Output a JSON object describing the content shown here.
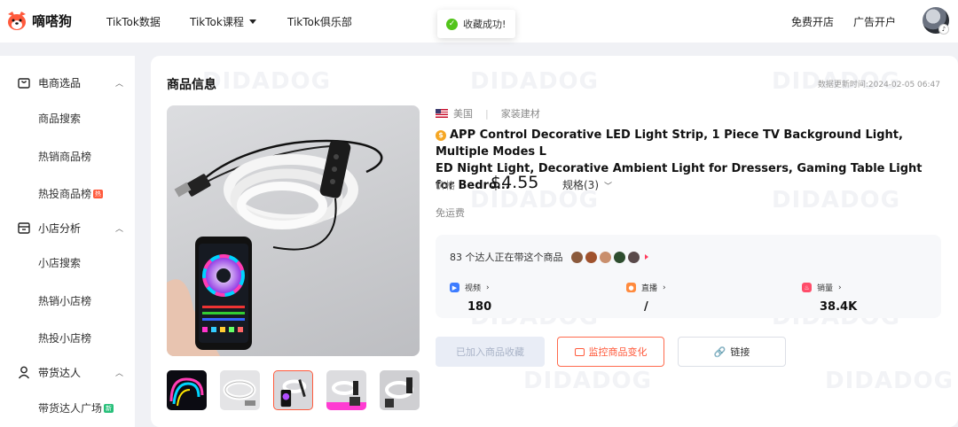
{
  "brand": {
    "name": "嘀嗒狗"
  },
  "nav": {
    "items": [
      "TikTok数据",
      "TikTok课程",
      "TikTok俱乐部"
    ],
    "right": [
      "免费开店",
      "广告开户"
    ]
  },
  "toast": {
    "text": "收藏成功!"
  },
  "sidebar": {
    "groups": [
      {
        "label": "电商选品",
        "items": [
          {
            "label": "商品搜索",
            "badge": ""
          },
          {
            "label": "热销商品榜",
            "badge": ""
          },
          {
            "label": "热投商品榜",
            "badge": "热"
          }
        ]
      },
      {
        "label": "小店分析",
        "items": [
          {
            "label": "小店搜索",
            "badge": ""
          },
          {
            "label": "热销小店榜",
            "badge": ""
          },
          {
            "label": "热投小店榜",
            "badge": ""
          }
        ]
      },
      {
        "label": "带货达人",
        "items": [
          {
            "label": "带货达人广场",
            "badge": "新"
          }
        ]
      }
    ]
  },
  "product": {
    "section_title": "商品信息",
    "update_time": "数据更新时间:2024-02-05 06:47",
    "country": "美国",
    "category": "家装建材",
    "title_line1": "APP Control Decorative LED Light Strip, 1 Piece TV Background Light, Multiple Modes L",
    "title_line2": "ED Night Light, Decorative Ambient Light for Dressers, Gaming Table Light for Bedro...",
    "price_label": "价格",
    "price": "$4.55",
    "spec": "规格(3)",
    "shipping": "免运费",
    "influencer_text": "83 个达人正在带这个商品",
    "stats": [
      {
        "label": "视频",
        "value": "180",
        "color": "#3d7cff"
      },
      {
        "label": "直播",
        "value": "/",
        "color": "#ff8a3d"
      },
      {
        "label": "销量",
        "value": "38.4K",
        "color": "#ff4d6a"
      }
    ],
    "buttons": {
      "favorited": "已加入商品收藏",
      "monitor": "监控商品变化",
      "link": "链接"
    }
  },
  "watermark": "DIDADOG",
  "colors": {
    "accent": "#ff5a3c",
    "success": "#52c41a"
  }
}
